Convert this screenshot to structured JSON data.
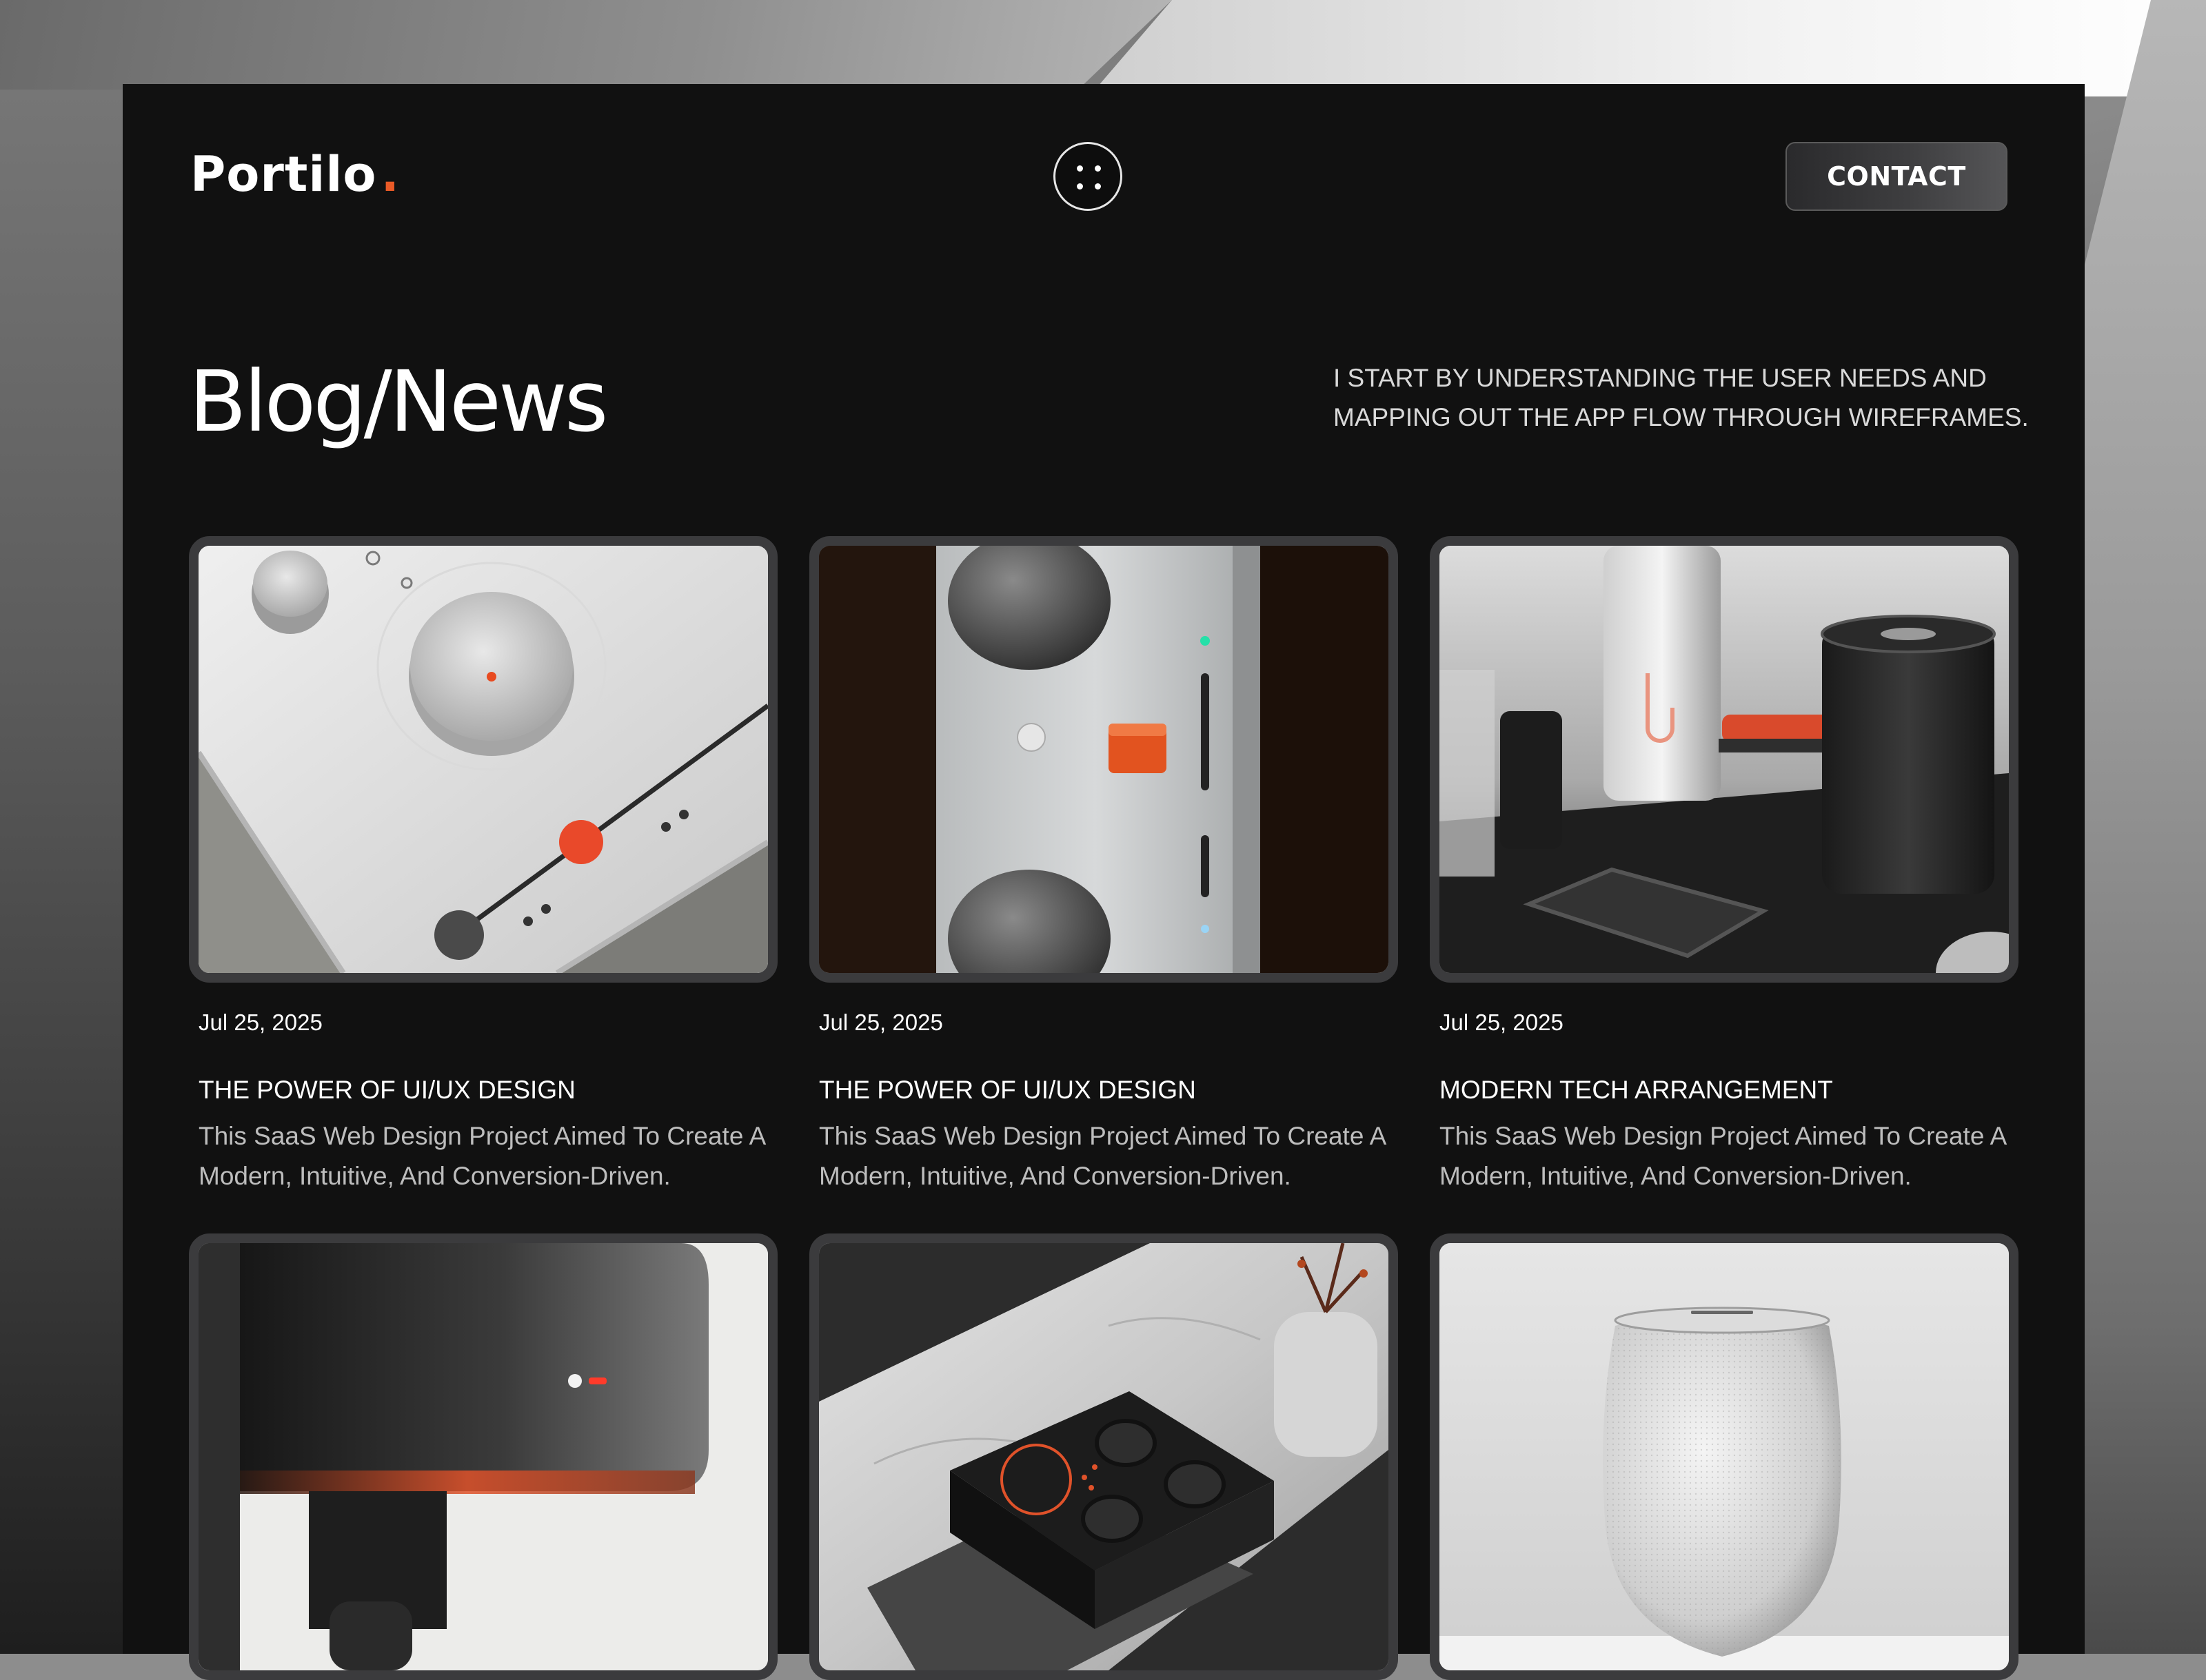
{
  "header": {
    "logo_text": "Portilo",
    "logo_dot": ".",
    "menu_icon": "four-dots-menu-icon",
    "contact_label": "CONTACT"
  },
  "hero": {
    "title": "Blog/News",
    "intro": "I START BY UNDERSTANDING THE USER NEEDS AND MAPPING OUT THE APP FLOW THROUGH WIREFRAMES."
  },
  "colors": {
    "accent": "#ea5a27",
    "panel": "#111111",
    "card_border": "#3b3b3d"
  },
  "posts": [
    {
      "image": "white-control-panel-with-red-slider",
      "date": "Jul 25, 2025",
      "title": "THE POWER OF UI/UX DESIGN",
      "description": "This SaaS Web Design Project Aimed To Create A Modern, Intuitive, And Conversion-Driven."
    },
    {
      "image": "silver-device-with-knurled-knobs",
      "date": "Jul 25, 2025",
      "title": "THE POWER OF UI/UX DESIGN",
      "description": "This SaaS Web Design Project Aimed To Create A Modern, Intuitive, And Conversion-Driven."
    },
    {
      "image": "tumbler-speaker-and-phone",
      "date": "Jul 25, 2025",
      "title": "MODERN TECH ARRANGEMENT",
      "description": "This SaaS Web Design Project Aimed To Create A Modern, Intuitive, And Conversion-Driven."
    },
    {
      "image": "black-device-with-red-light"
    },
    {
      "image": "black-controller-on-marble-table"
    },
    {
      "image": "white-fabric-smart-speaker"
    }
  ]
}
